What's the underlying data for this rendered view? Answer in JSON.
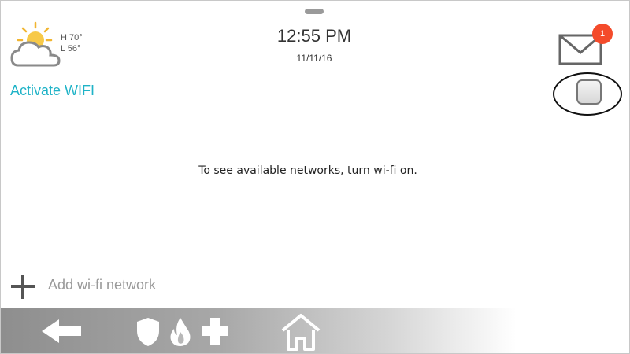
{
  "weather": {
    "high": "H 70°",
    "low": "L 56°",
    "icon": "partly-cloudy-icon"
  },
  "clock": {
    "time": "12:55 PM",
    "date": "11/11/16"
  },
  "messages": {
    "badge_count": "1",
    "icon": "mail-icon"
  },
  "wifi": {
    "label": "Activate WIFI",
    "enabled": false
  },
  "content": {
    "message": "To see available networks, turn wi-fi on."
  },
  "add_network": {
    "label": "Add wi-fi network",
    "icon": "plus-icon"
  },
  "navbar": {
    "icons": [
      "back-arrow-icon",
      "shield-icon",
      "fire-icon",
      "medical-cross-icon",
      "home-icon"
    ]
  },
  "colors": {
    "accent": "#1fb3c7",
    "badge": "#f44b2b",
    "nav_gray": "#8e8e8e"
  }
}
